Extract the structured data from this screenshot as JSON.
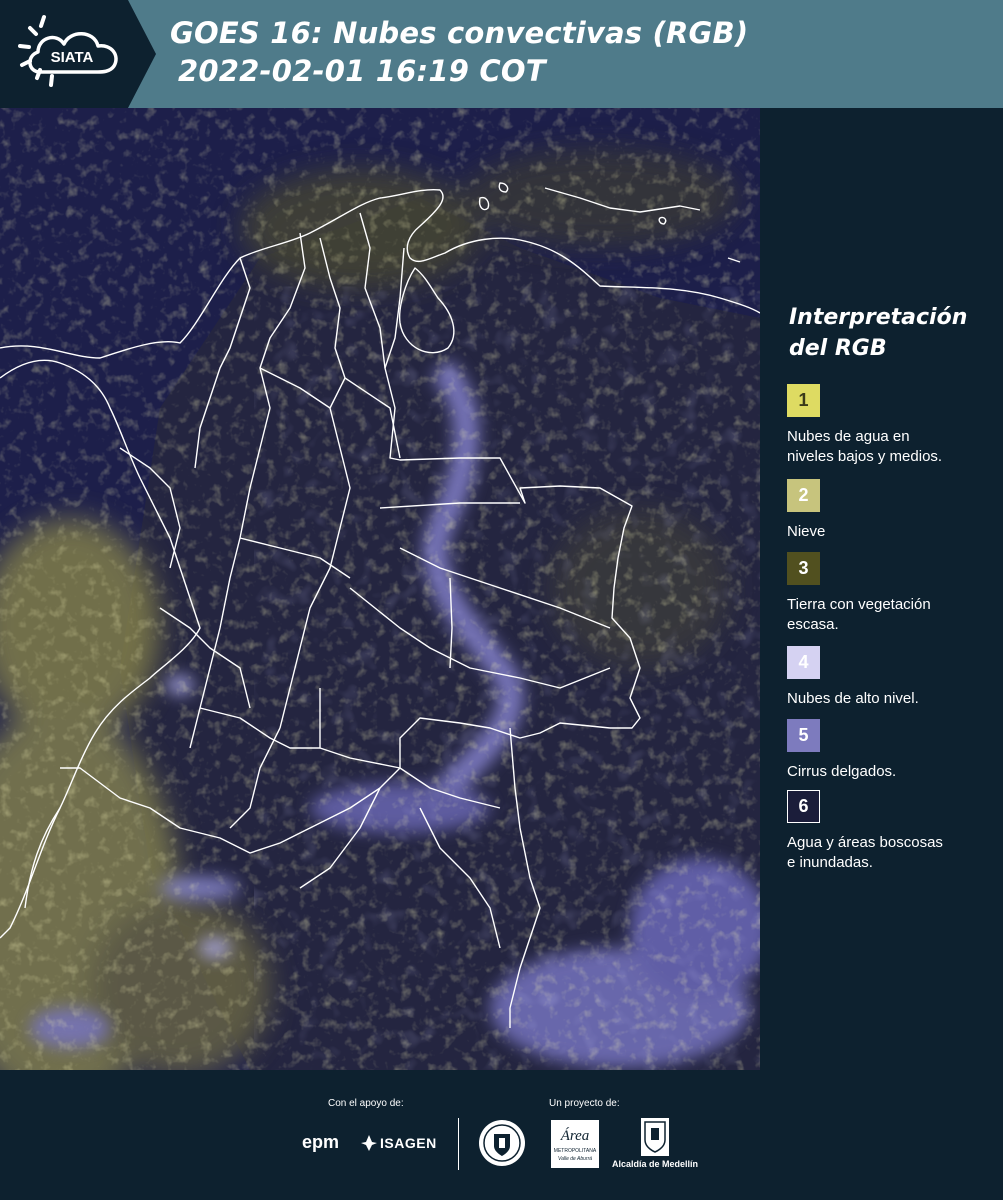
{
  "header": {
    "logo_text": "SIATA",
    "title_line1": "GOES 16: Nubes convectivas (RGB)",
    "title_line2": "2022-02-01 16:19 COT"
  },
  "legend": {
    "title_line1": "Interpretación",
    "title_line2": "del RGB",
    "items": [
      {
        "number": "1",
        "label_line1": "Nubes de agua en",
        "label_line2": "niveles bajos y medios.",
        "color": "#dedb62",
        "text_color": "#3a3a1a"
      },
      {
        "number": "2",
        "label_line1": "Nieve",
        "label_line2": "",
        "color": "#c7c47d",
        "text_color": "#ffffff"
      },
      {
        "number": "3",
        "label_line1": "Tierra con vegetación",
        "label_line2": "escasa.",
        "color": "#51501f",
        "text_color": "#ffffff"
      },
      {
        "number": "4",
        "label_line1": "Nubes de alto nivel.",
        "label_line2": "",
        "color": "#d5d2f2",
        "text_color": "#ffffff"
      },
      {
        "number": "5",
        "label_line1": "Cirrus delgados.",
        "label_line2": "",
        "color": "#7d7bbe",
        "text_color": "#ffffff"
      },
      {
        "number": "6",
        "label_line1": "Agua y áreas boscosas",
        "label_line2": "e inundadas.",
        "color": "#1b1d3a",
        "text_color": "#ffffff"
      }
    ]
  },
  "footer": {
    "support_label": "Con el apoyo de:",
    "project_label": "Un proyecto de:",
    "sponsor_1": "epm",
    "sponsor_2": "ISAGEN",
    "partner_1_line1": "Área",
    "partner_1_line2": "METROPOLITANA",
    "partner_1_line3": "Valle de Aburrá",
    "partner_2": "Alcaldía de Medellín"
  },
  "colors": {
    "header_bg": "#4f7b8a",
    "panel_bg": "#0d212f",
    "ocean": "#1d1f4a",
    "low_cloud": "#dedb62",
    "high_cloud": "#9a9ae8",
    "boundary": "#ffffff"
  }
}
